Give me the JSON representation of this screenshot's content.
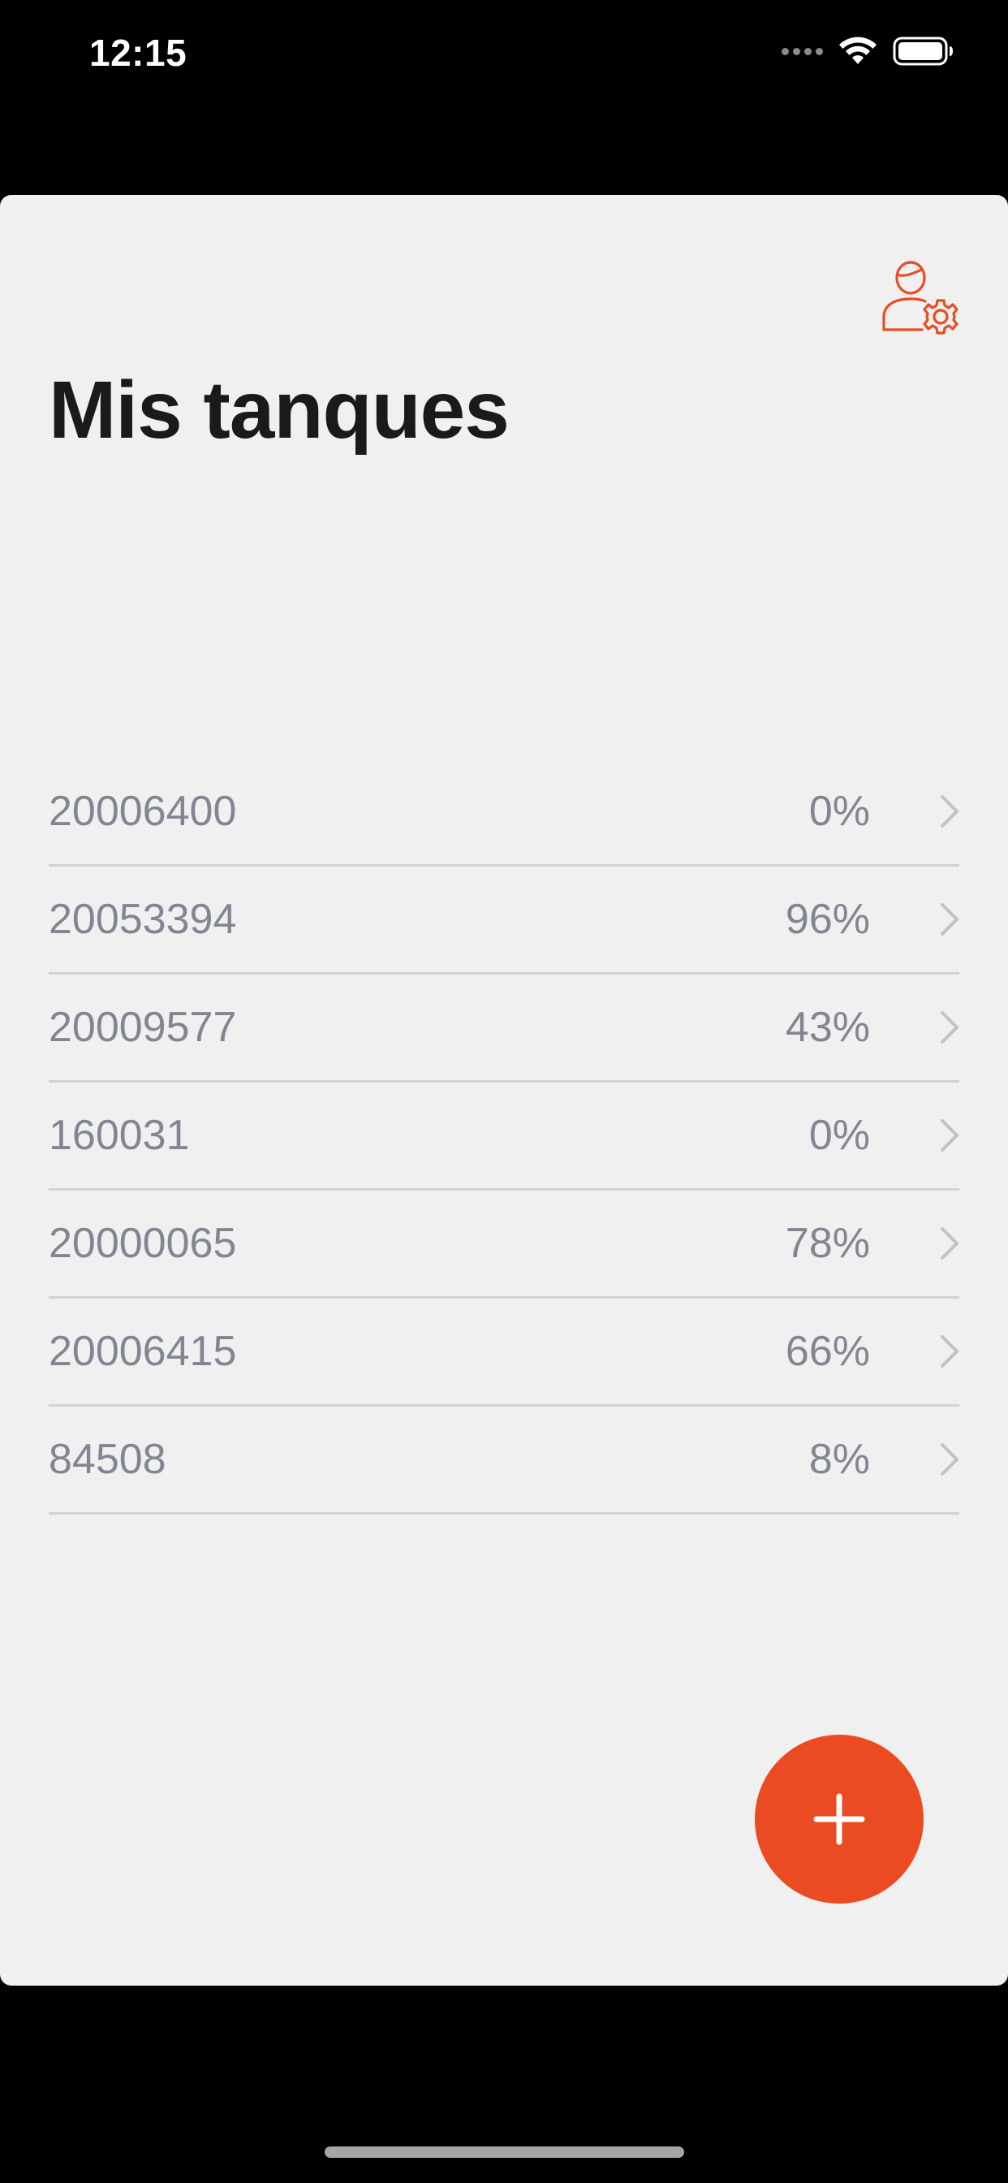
{
  "status_bar": {
    "time": "12:15"
  },
  "header": {
    "title": "Mis tanques",
    "settings_icon": "user-settings-icon"
  },
  "tanks": [
    {
      "id": "20006400",
      "level": "0%"
    },
    {
      "id": "20053394",
      "level": "96%"
    },
    {
      "id": "20009577",
      "level": "43%"
    },
    {
      "id": "160031",
      "level": "0%"
    },
    {
      "id": "20000065",
      "level": "78%"
    },
    {
      "id": "20006415",
      "level": "66%"
    },
    {
      "id": "84508",
      "level": "8%"
    }
  ],
  "fab": {
    "icon": "plus-icon"
  },
  "colors": {
    "accent": "#ea4b22",
    "background": "#f0f0f0",
    "text_primary": "#1a1a1a",
    "text_secondary": "#828693",
    "divider": "#d2d2d2"
  }
}
